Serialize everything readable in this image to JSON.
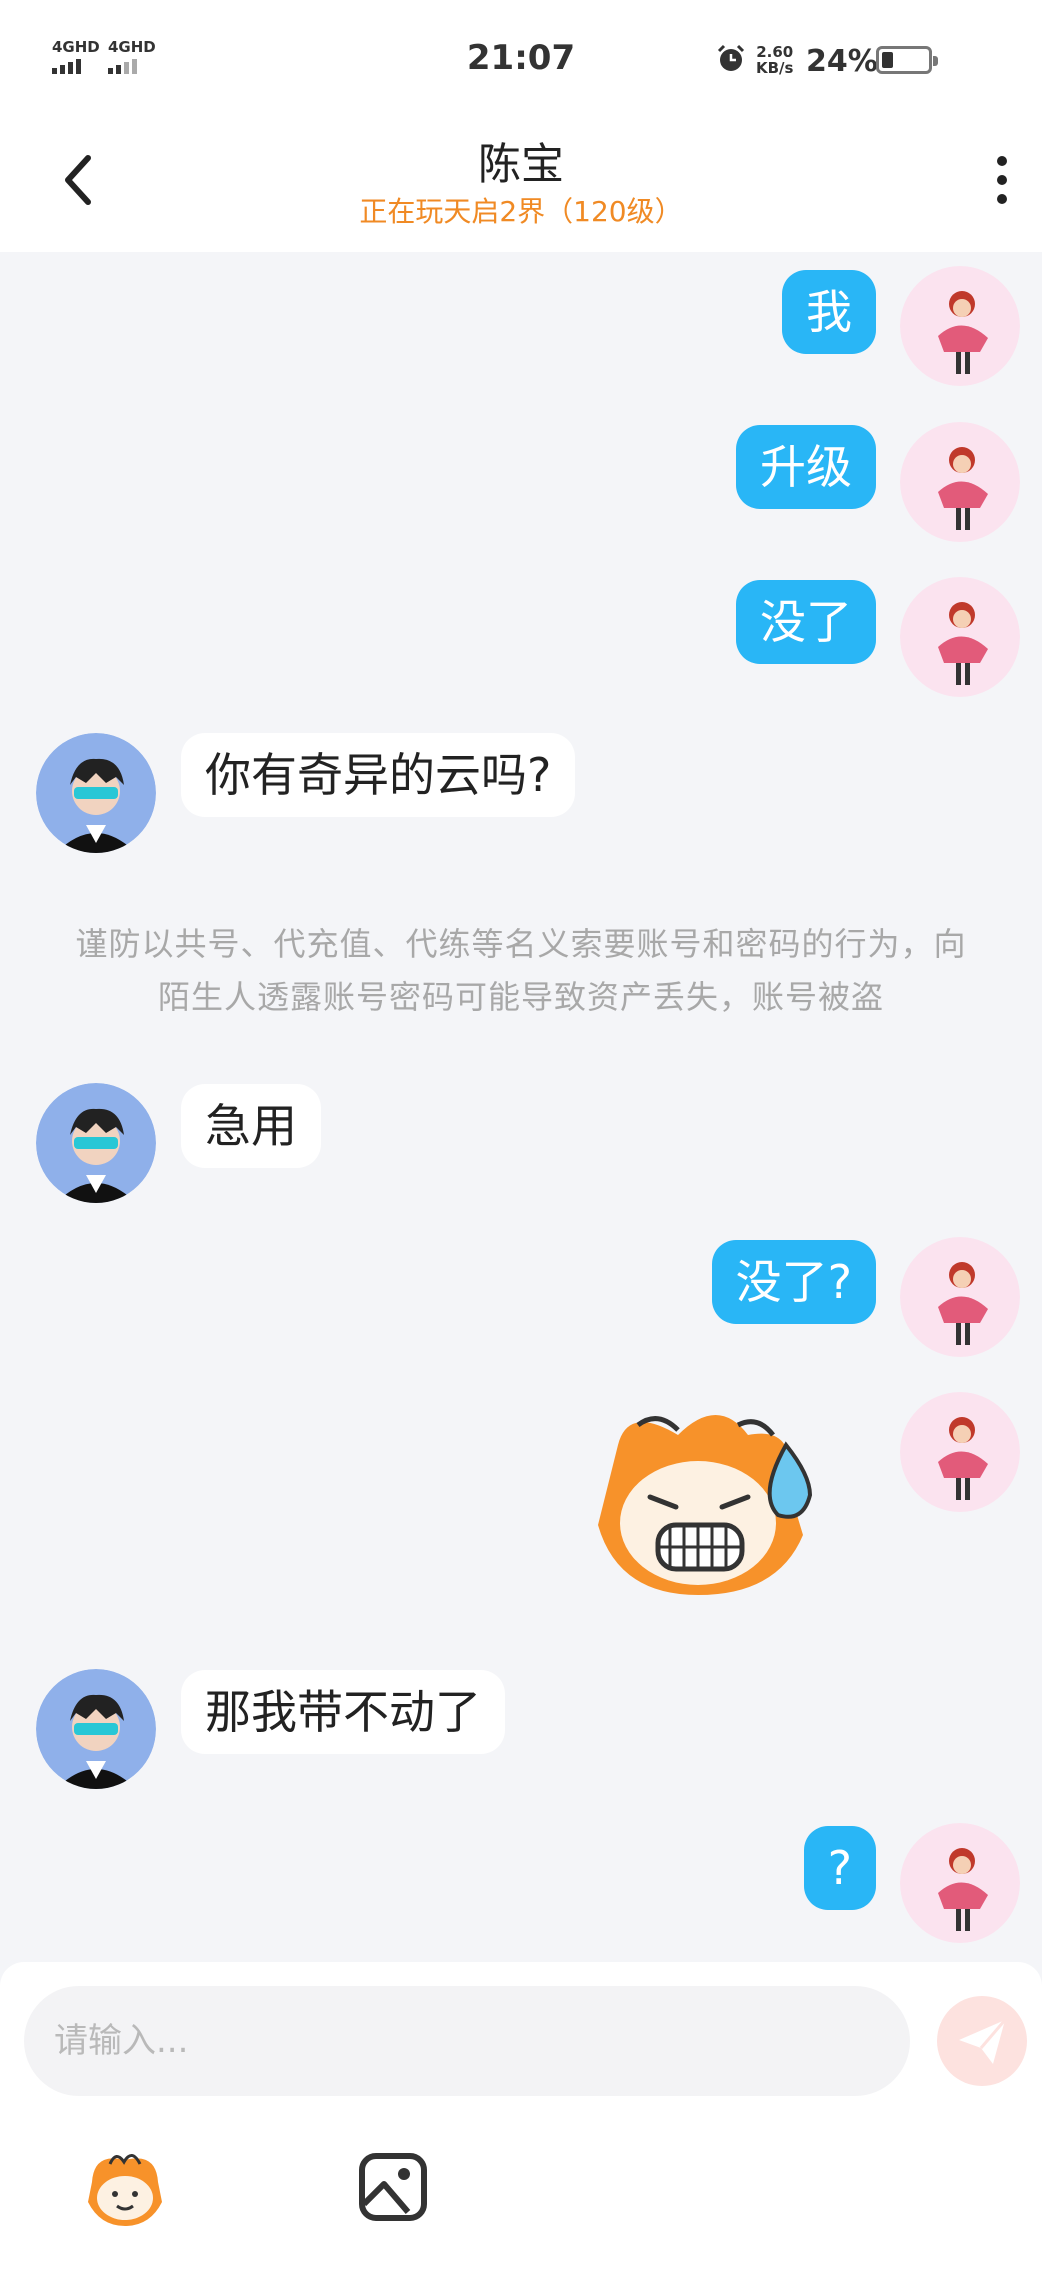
{
  "status_bar": {
    "sim1": "4GHD",
    "sim2": "4GHD",
    "time": "21:07",
    "net_speed": "2.60",
    "net_unit": "KB/s",
    "battery": "24%",
    "battery_level": 0.24
  },
  "header": {
    "title": "陈宝",
    "subtitle": "正在玩天启2界（120级）"
  },
  "messages": [
    {
      "from": "me",
      "text": "我"
    },
    {
      "from": "me",
      "text": "升级"
    },
    {
      "from": "me",
      "text": "没了"
    },
    {
      "from": "them",
      "text": "你有奇异的云吗?"
    },
    {
      "from": "system",
      "text": "谨防以共号、代充值、代练等名义索要账号和密码的行为，向陌生人透露账号密码可能导致资产丢失，账号被盗"
    },
    {
      "from": "them",
      "text": "急用"
    },
    {
      "from": "me",
      "text": "没了?"
    },
    {
      "from": "me",
      "type": "sticker",
      "sticker": "sweating-grimace-sticker"
    },
    {
      "from": "them",
      "text": "那我带不动了"
    },
    {
      "from": "me",
      "text": "?"
    }
  ],
  "input": {
    "placeholder": "请输入..."
  },
  "colors": {
    "accent": "#29b6f6",
    "subtitle": "#f08a24",
    "background": "#f4f5f8"
  },
  "icons": [
    "back-arrow-icon",
    "more-dots-icon",
    "send-icon",
    "emoji-icon",
    "image-icon",
    "alarm-icon",
    "battery-icon"
  ]
}
